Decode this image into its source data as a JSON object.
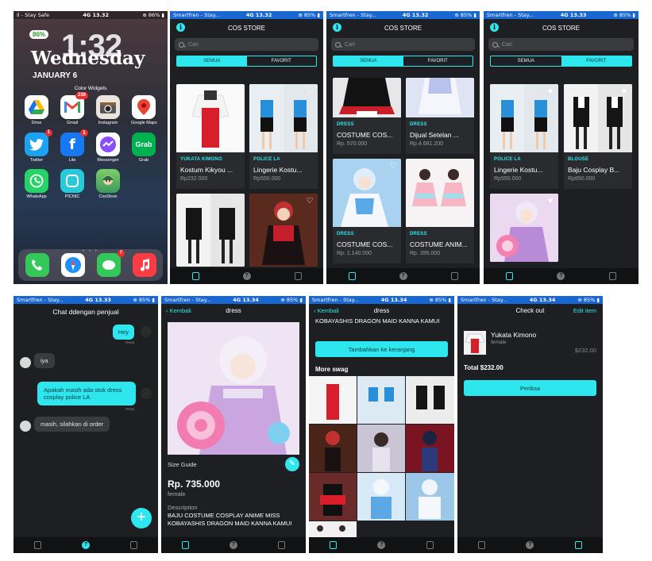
{
  "status": {
    "home_carrier": "il - Stay Safe",
    "carrier": "Smartfren - Stay...",
    "network": "4G",
    "time1": "13.32",
    "time2": "13.33",
    "time3": "13.34",
    "battery": "85%"
  },
  "home": {
    "battery_widget": "86%",
    "clock": "1:32",
    "weekday": "Wednesday",
    "date": "JANUARY 6",
    "widget_title": "Color Widgets",
    "apps": [
      {
        "label": "Drive",
        "color": "#ffffff"
      },
      {
        "label": "Gmail",
        "color": "#ffffff",
        "badge": "238"
      },
      {
        "label": "Instagram",
        "color": "#e9e4dc"
      },
      {
        "label": "Google Maps",
        "color": "#ffffff"
      },
      {
        "label": "Twitter",
        "color": "#1da1f2",
        "badge": "1"
      },
      {
        "label": "Lite",
        "color": "#1877f2",
        "badge": "1"
      },
      {
        "label": "Messenger",
        "color": "#8a4dff"
      },
      {
        "label": "Grab",
        "color": "#00b14f"
      },
      {
        "label": "WhatsApp",
        "color": "#25d366"
      },
      {
        "label": "PICNIC",
        "color": "#28c9d8"
      },
      {
        "label": "CosStore",
        "color": "#6fbf4a"
      }
    ],
    "dock_badge": "7"
  },
  "store": {
    "title": "COS STORE",
    "search_placeholder": "Cari",
    "tab_all": "SEMUA",
    "tab_fav": "FAVORIT",
    "info_icon": "i"
  },
  "screen2_cards": [
    {
      "category": "YUKATA KIMONO",
      "name": "Kostum Kikyou ...",
      "price": "Rp232.000"
    },
    {
      "category": "POLICE LA",
      "name": "Lingerie Kostu...",
      "price": "Rp550.000"
    }
  ],
  "screen3_cards": [
    {
      "category": "DRESS",
      "name": "COSTUME COS...",
      "price": "Rp. 570.000"
    },
    {
      "category": "DRESS",
      "name": "Dijual Setelan ...",
      "price": "Rp.4.681.200"
    },
    {
      "category": "DRESS",
      "name": "COSTUME COS...",
      "price": "Rp. 1.140.000"
    },
    {
      "category": "DRESS",
      "name": "COSTUME ANIM...",
      "price": "Rp. 395.000"
    }
  ],
  "screen4_cards": [
    {
      "category": "POLICE LA",
      "name": "Lingerie Kostu...",
      "price": "Rp550.000"
    },
    {
      "category": "BLOUSE",
      "name": "Baju Cosplay B...",
      "price": "Rp850.000"
    }
  ],
  "chat": {
    "title": "Chat ddengan penjual",
    "messages": [
      {
        "from": "me",
        "text": "Hey",
        "meta": "Read"
      },
      {
        "from": "them",
        "text": "iya"
      },
      {
        "from": "me",
        "text": "Apakah masih ada stok  dress cosplay  police LA",
        "meta": "Read"
      },
      {
        "from": "them",
        "text": "masih, silahkan di order"
      }
    ],
    "fab": "+"
  },
  "detail": {
    "back": "Kembali",
    "title": "dress",
    "size_guide": "Size Guide",
    "price": "Rp. 735.000",
    "gender": "female",
    "desc_label": "Description",
    "desc": "BAJU COSTUME COSPLAY ANIME MISS KOBAYASHIS DRAGON MAID KANNA KAMUI"
  },
  "detail2": {
    "desc_tail": "KOBAYASHIS DRAGON MAID KANNA KAMUI",
    "add_cart": "Tambahkan ke keranjang",
    "more": "More swag"
  },
  "checkout": {
    "title": "Check out",
    "edit": "Edit item",
    "item_name": "Yukata Kimono",
    "item_gender": "female",
    "item_price": "$232.00",
    "total": "Total $232.00",
    "button": "Periksa"
  },
  "colors": {
    "accent": "#2ee6ee",
    "bg": "#1e1f22"
  }
}
